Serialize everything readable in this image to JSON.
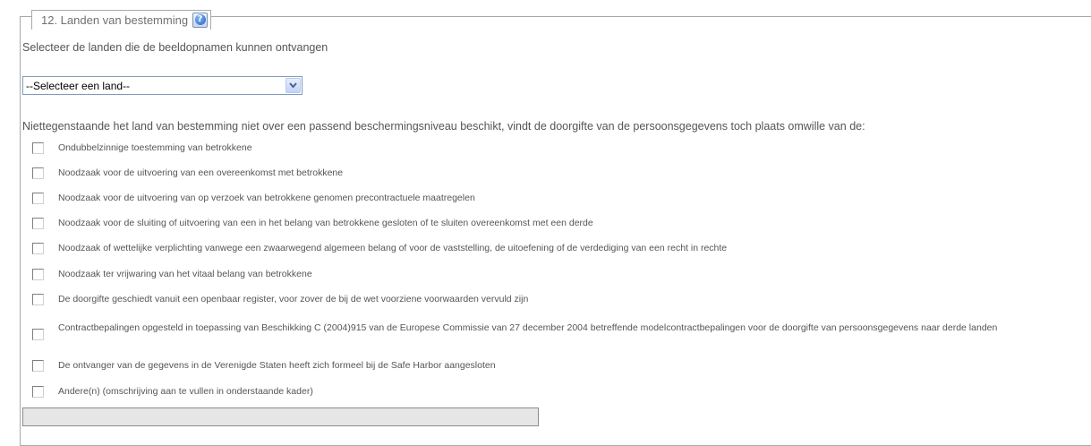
{
  "section": {
    "legend": "12. Landen van bestemming",
    "help_icon": "help-icon"
  },
  "intro": "Selecteer de landen die de beeldopnamen kunnen ontvangen",
  "country_select": {
    "value": "--Selecteer een land--",
    "icon": "chevron-down-icon"
  },
  "notwithstanding": "Niettegenstaande het land van bestemming niet over een passend beschermingsniveau beschikt, vindt de doorgifte van de persoonsgegevens toch plaats omwille van de:",
  "options": [
    {
      "label": "Ondubbelzinnige toestemming van betrokkene",
      "checked": false
    },
    {
      "label": "Noodzaak voor de uitvoering van een overeenkomst met betrokkene",
      "checked": false
    },
    {
      "label": "Noodzaak voor de uitvoering van op verzoek van betrokkene genomen precontractuele maatregelen",
      "checked": false
    },
    {
      "label": "Noodzaak voor de sluiting of uitvoering van een in het belang van betrokkene gesloten of te sluiten overeenkomst met een derde",
      "checked": false
    },
    {
      "label": "Noodzaak of wettelijke verplichting vanwege een zwaarwegend algemeen belang of voor de vaststelling, de uitoefening of de verdediging van een recht in rechte",
      "checked": false
    },
    {
      "label": "Noodzaak ter vrijwaring van het vitaal belang van betrokkene",
      "checked": false
    },
    {
      "label": "De doorgifte geschiedt vanuit een openbaar register, voor zover de bij de wet voorziene voorwaarden vervuld zijn",
      "checked": false
    },
    {
      "label": "Contractbepalingen opgesteld in toepassing van Beschikking C (2004)915 van de Europese Commissie van 27 december 2004 betreffende modelcontractbepalingen voor de doorgifte van persoonsgegevens naar derde landen",
      "checked": false
    },
    {
      "label": "De ontvanger van de gegevens in de Verenigde Staten heeft zich formeel bij de Safe Harbor aangesloten",
      "checked": false
    },
    {
      "label": "Andere(n) (omschrijving aan te vullen in onderstaande kader)",
      "checked": false
    }
  ],
  "other_field": {
    "value": ""
  }
}
